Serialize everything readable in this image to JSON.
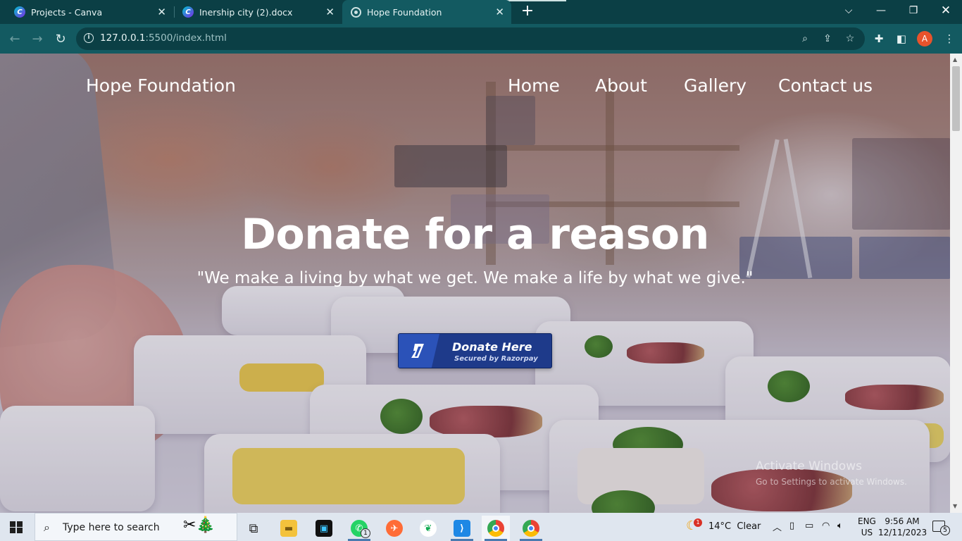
{
  "browser": {
    "tabs": [
      {
        "title": "Projects - Canva",
        "icon": "canva-icon"
      },
      {
        "title": "Inership city (2).docx",
        "icon": "canva-icon"
      },
      {
        "title": "Hope Foundation",
        "icon": "broadcast-icon",
        "active": true
      }
    ],
    "url_host": "127.0.0.1",
    "url_path": ":5500/index.html",
    "profile_initial": "A"
  },
  "site": {
    "brand": "Hope Foundation",
    "nav": [
      "Home",
      "About",
      "Gallery",
      "Contact us"
    ],
    "hero_title": "Donate for a reason",
    "hero_quote": "\"We make a living by what we get. We make a life by what we give.\"",
    "donate_label": "Donate Here",
    "donate_sub": "Secured by Razorpay"
  },
  "watermark": {
    "line1": "Activate Windows",
    "line2": "Go to Settings to activate Windows."
  },
  "taskbar": {
    "search_placeholder": "Type here to search",
    "whatsapp_badge": "1",
    "weather_badge": "1",
    "weather": "14°C  Clear",
    "lang_top": "ENG",
    "lang_bottom": "US",
    "time": "9:56 AM",
    "date": "12/11/2023",
    "notification_count": "5"
  },
  "colors": {
    "chrome_dark": "#0b3f45",
    "chrome_toolbar": "#135a61",
    "razorpay_blue": "#1e3a8a"
  }
}
